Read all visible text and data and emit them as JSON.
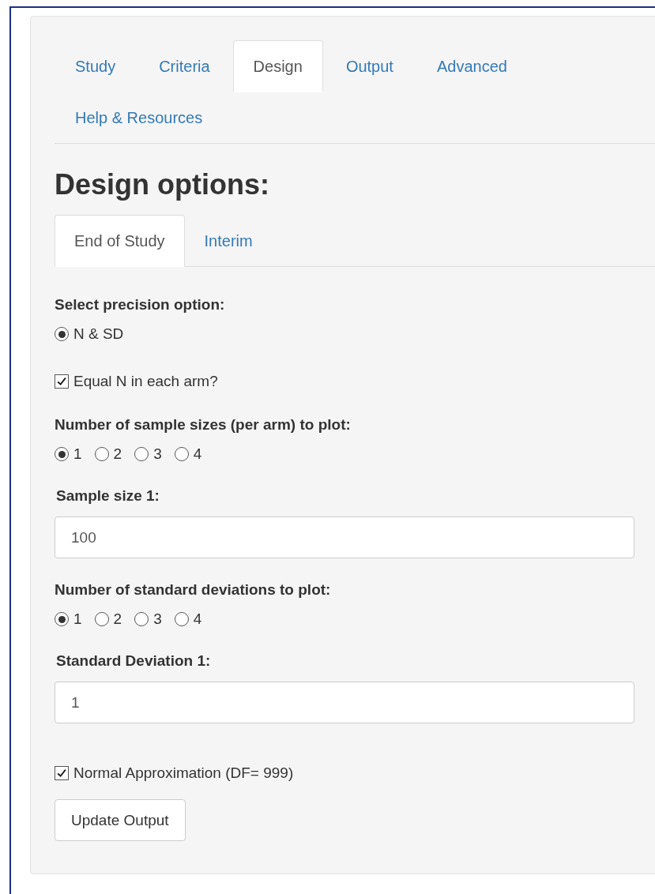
{
  "tabs": [
    {
      "label": "Study",
      "selected": false
    },
    {
      "label": "Criteria",
      "selected": false
    },
    {
      "label": "Design",
      "selected": true
    },
    {
      "label": "Output",
      "selected": false
    },
    {
      "label": "Advanced",
      "selected": false
    },
    {
      "label": "Help & Resources",
      "selected": false
    }
  ],
  "heading": "Design options:",
  "subtabs": [
    {
      "label": "End of Study",
      "selected": true
    },
    {
      "label": "Interim",
      "selected": false
    }
  ],
  "precision": {
    "label": "Select precision option:",
    "options": [
      {
        "label": "N & SD",
        "selected": true
      }
    ]
  },
  "equal_n": {
    "label": "Equal N in each arm?",
    "checked": true
  },
  "sample_count": {
    "label": "Number of sample sizes (per arm) to plot:",
    "options": [
      {
        "label": "1",
        "selected": true
      },
      {
        "label": "2",
        "selected": false
      },
      {
        "label": "3",
        "selected": false
      },
      {
        "label": "4",
        "selected": false
      }
    ]
  },
  "sample_sizes": [
    {
      "label": "Sample size 1:",
      "value": "100"
    }
  ],
  "sd_count": {
    "label": "Number of standard deviations to plot:",
    "options": [
      {
        "label": "1",
        "selected": true
      },
      {
        "label": "2",
        "selected": false
      },
      {
        "label": "3",
        "selected": false
      },
      {
        "label": "4",
        "selected": false
      }
    ]
  },
  "standard_deviations": [
    {
      "label": "Standard Deviation 1:",
      "value": "1"
    }
  ],
  "normal_approx": {
    "label": "Normal Approximation (DF= 999)",
    "checked": true
  },
  "button": "Update Output"
}
